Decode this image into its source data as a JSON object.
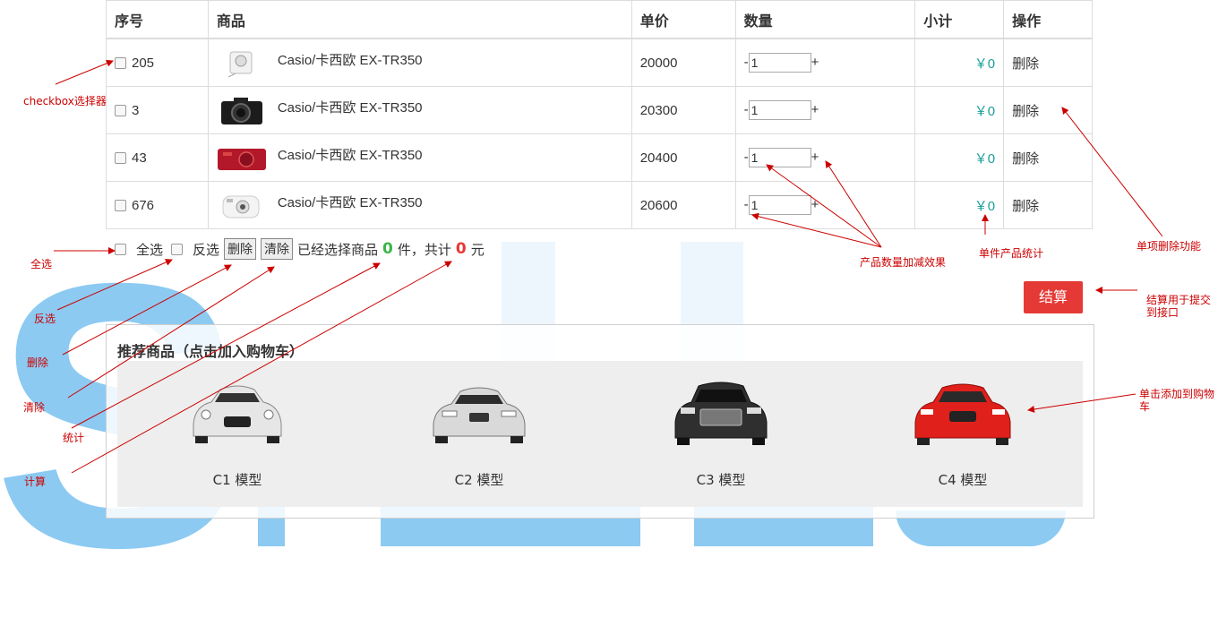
{
  "table": {
    "headers": {
      "id": "序号",
      "goods": "商品",
      "price": "单价",
      "qty": "数量",
      "subtotal": "小计",
      "op": "操作"
    },
    "rows": [
      {
        "id": "205",
        "name": "Casio/卡西欧 EX-TR350",
        "price": "20000",
        "qty": "1",
        "minus": "-",
        "plus": "+",
        "subtotal": "￥0",
        "op": "删除",
        "thumb": "white-camera"
      },
      {
        "id": "3",
        "name": "Casio/卡西欧 EX-TR350",
        "price": "20300",
        "qty": "1",
        "minus": "-",
        "plus": "+",
        "subtotal": "￥0",
        "op": "删除",
        "thumb": "black-camera"
      },
      {
        "id": "43",
        "name": "Casio/卡西欧 EX-TR350",
        "price": "20400",
        "qty": "1",
        "minus": "-",
        "plus": "+",
        "subtotal": "￥0",
        "op": "删除",
        "thumb": "red-camera"
      },
      {
        "id": "676",
        "name": "Casio/卡西欧 EX-TR350",
        "price": "20600",
        "qty": "1",
        "minus": "-",
        "plus": "+",
        "subtotal": "￥0",
        "op": "删除",
        "thumb": "instant-camera"
      }
    ]
  },
  "bar": {
    "select_all": "全选",
    "invert": "反选",
    "delete_btn": "删除",
    "clear_btn": "清除",
    "selected_prefix": "已经选择商品",
    "count": "0",
    "count_unit": "件，共计",
    "total": "0",
    "currency": "元"
  },
  "checkout": "结算",
  "recommend": {
    "title": "推荐商品（点击加入购物车）",
    "items": [
      {
        "name": "C1 模型",
        "color": "#e6e6e6"
      },
      {
        "name": "C2 模型",
        "color": "#d9d9d9"
      },
      {
        "name": "C3 模型",
        "color": "#2f2f2f"
      },
      {
        "name": "C4 模型",
        "color": "#e0201b"
      }
    ]
  },
  "annotations": {
    "checkbox": "checkbox选择器",
    "select_all": "全选",
    "invert": "反选",
    "delete": "删除",
    "clear": "清除",
    "stats": "统计",
    "calc": "计算",
    "qty_effect": "产品数量加减效果",
    "item_stats": "单件产品统计",
    "single_delete": "单项删除功能",
    "checkout_note_1": "结算用于提交",
    "checkout_note_2": "到接口",
    "add_cart_1": "单击添加到购物",
    "add_cart_2": "车"
  },
  "colors": {
    "accent_red": "#e53935",
    "subtotal": "#1aa09a",
    "count_green": "#3ab54a",
    "annotation": "#cc0000"
  }
}
